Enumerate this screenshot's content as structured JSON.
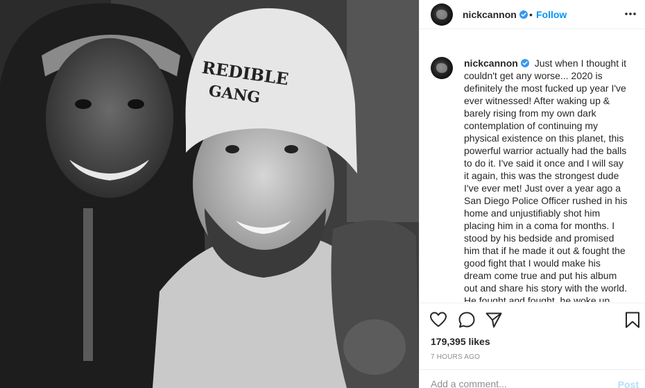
{
  "header": {
    "username": "nickcannon",
    "separator": "•",
    "follow_label": "Follow"
  },
  "caption": {
    "username": "nickcannon",
    "text": "Just when I thought it couldn't get any worse... 2020 is definitely the most fucked up year I've ever witnessed! After waking up & barely rising from my own dark contemplation of continuing my physical existence on this planet, this powerful warrior actually had the balls to do it. I've said it once and I will say it again, this was the strongest dude I've ever met! Just over a year ago a San Diego Police Officer rushed in his home and unjustifiably shot him placing him in a coma for months. I stood by his bedside and promised him that if he made it out & fought the good fight that I would make his dream come true and put his album out and share his story with the world. He fought and fought, he woke up"
  },
  "photo": {
    "beanie_text_line1": "REDIBLE",
    "beanie_text_line2": "GANG"
  },
  "actions": {
    "likes": "179,395 likes",
    "timestamp": "7 HOURS AGO"
  },
  "comment": {
    "placeholder": "Add a comment...",
    "post_label": "Post"
  },
  "icons": {
    "like": "heart-icon",
    "comment": "comment-bubble-icon",
    "share": "paper-plane-icon",
    "save": "bookmark-icon",
    "more": "more-options-icon",
    "verified": "verified-badge-icon"
  },
  "colors": {
    "link_blue": "#0095f6",
    "verified_blue": "#3897f0",
    "post_disabled": "#b2dffc",
    "muted_text": "#8e8e8e",
    "border": "#efefef"
  }
}
